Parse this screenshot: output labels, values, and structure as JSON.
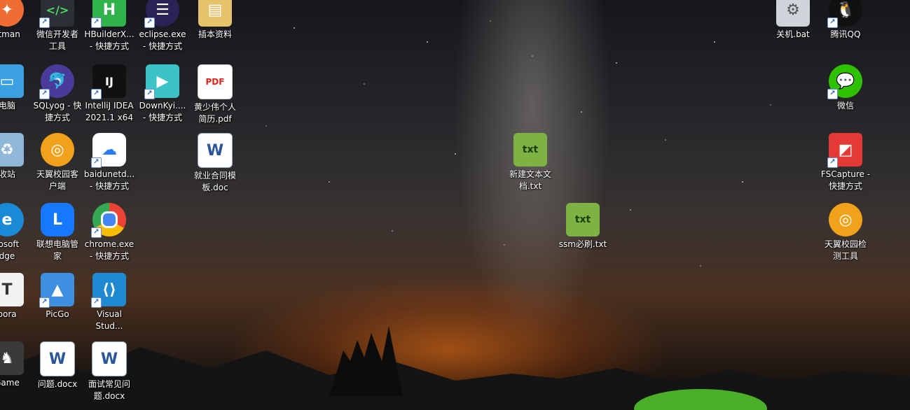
{
  "desktop": {
    "icons": [
      {
        "label": "stman",
        "icon": "postman-icon",
        "color": "#ef6c33"
      },
      {
        "label": "微信开发者\n工具",
        "icon": "wechat-devtools-icon",
        "color": "#2b2f36"
      },
      {
        "label": "HBuilderX...\n- 快捷方式",
        "icon": "hbuilderx-icon",
        "color": "#2fb34a"
      },
      {
        "label": "eclipse.exe\n- 快捷方式",
        "icon": "eclipse-icon",
        "color": "#2c2255"
      },
      {
        "label": "插本资料",
        "icon": "folder-icon",
        "color": "#e6c26b"
      },
      {
        "label": "电脑",
        "icon": "this-pc-icon",
        "color": "#3ba0e0"
      },
      {
        "label": "SQLyog - 快\n捷方式",
        "icon": "sqlyog-icon",
        "color": "#4a3a9a"
      },
      {
        "label": "IntelliJ IDEA\n2021.1 x64",
        "icon": "intellij-icon",
        "color": "#111"
      },
      {
        "label": "DownKyi....\n- 快捷方式",
        "icon": "downkyi-icon",
        "color": "#3cc3c8"
      },
      {
        "label": "黄少伟个人\n简历.pdf",
        "icon": "pdf-icon",
        "color": "#e2231a"
      },
      {
        "label": "收站",
        "icon": "recycle-bin-icon",
        "color": "#8fb8d8"
      },
      {
        "label": "天翼校园客\n户端",
        "icon": "tianyi-client-icon",
        "color": "#f2a21a"
      },
      {
        "label": "baidunetd...\n- 快捷方式",
        "icon": "baidu-netdisk-icon",
        "color": "#ffffff"
      },
      {
        "label": "就业合同模\n板.doc",
        "icon": "word-doc-icon",
        "color": "#2b579a"
      },
      {
        "label": "新建文本文\n档.txt",
        "icon": "notepad-txt-icon",
        "color": "#7cb342"
      },
      {
        "label": "ssm必刷.txt",
        "icon": "notepad-txt-icon",
        "color": "#7cb342"
      },
      {
        "label": "rosoft\ndge",
        "icon": "edge-icon",
        "color": "#1b8ad6"
      },
      {
        "label": "联想电脑管\n家",
        "icon": "lenovo-manager-icon",
        "color": "#1677ff"
      },
      {
        "label": "chrome.exe\n- 快捷方式",
        "icon": "chrome-icon",
        "color": "#ea4335"
      },
      {
        "label": "pora",
        "icon": "typora-icon",
        "color": "#f2f2f2"
      },
      {
        "label": "PicGo",
        "icon": "picgo-icon",
        "color": "#3d8fe0"
      },
      {
        "label": "Visual\nStud...",
        "icon": "vscode-icon",
        "color": "#1f8ad2"
      },
      {
        "label": "Game",
        "icon": "game-icon",
        "color": "#3a3a3a"
      },
      {
        "label": "问题.docx",
        "icon": "word-docx-icon",
        "color": "#2b579a"
      },
      {
        "label": "面试常见问\n题.docx",
        "icon": "word-docx-icon",
        "color": "#2b579a"
      },
      {
        "label": "关机.bat",
        "icon": "bat-file-icon",
        "color": "#d0d4da"
      },
      {
        "label": "腾讯QQ",
        "icon": "qq-icon",
        "color": "#111"
      },
      {
        "label": "微信",
        "icon": "wechat-icon",
        "color": "#2dc100"
      },
      {
        "label": "FSCapture -\n快捷方式",
        "icon": "fscapture-icon",
        "color": "#e53935"
      },
      {
        "label": "天翼校园检\n测工具",
        "icon": "tianyi-check-icon",
        "color": "#f2a21a"
      }
    ]
  }
}
